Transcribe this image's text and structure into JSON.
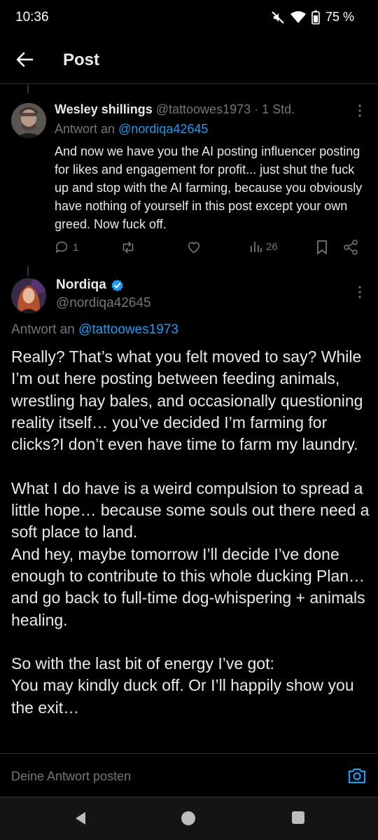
{
  "status": {
    "time": "10:36",
    "battery": "75 %"
  },
  "header": {
    "title": "Post"
  },
  "reply": {
    "author_name": "Wesley shillings",
    "author_handle": "@tattoowes1973",
    "separator": "·",
    "time": "1 Std.",
    "reply_prefix": "Antwort an",
    "reply_to": "@nordiqa42645",
    "text": "And now we have you the AI posting influencer posting for likes and engagement for profit... just shut the fuck up and stop with the AI farming, because you obviously have nothing of yourself in this post except your own greed. Now fuck off.",
    "reply_count": "1",
    "view_count": "26"
  },
  "post": {
    "author_name": "Nordiqa",
    "author_handle": "@nordiqa42645",
    "reply_prefix": "Antwort an",
    "reply_to": "@tattoowes1973",
    "para1": "Really? That’s what you felt moved to say? While I’m out here posting between feeding animals, wrestling hay bales, and occasionally questioning reality itself… you’ve decided I’m farming for clicks?I don’t even have time to farm my laundry.",
    "para2a": "What I do have is a weird compulsion to spread a little hope… because some souls out there need a soft place to land.",
    "para2b": "And hey, maybe tomorrow I’ll decide I’ve done enough to contribute to this whole ducking Plan… and go back to full-time dog-whispering + animals healing.",
    "para3a": "So with the last bit of energy I’ve got:",
    "para3b": "You may kindly duck off. Or I’ll happily show you the exit…"
  },
  "reply_bar": {
    "placeholder": "Deine Antwort posten"
  },
  "colors": {
    "accent": "#1d9bf0",
    "background": "#000000",
    "text": "#e7e9ea",
    "muted": "#71767b"
  }
}
